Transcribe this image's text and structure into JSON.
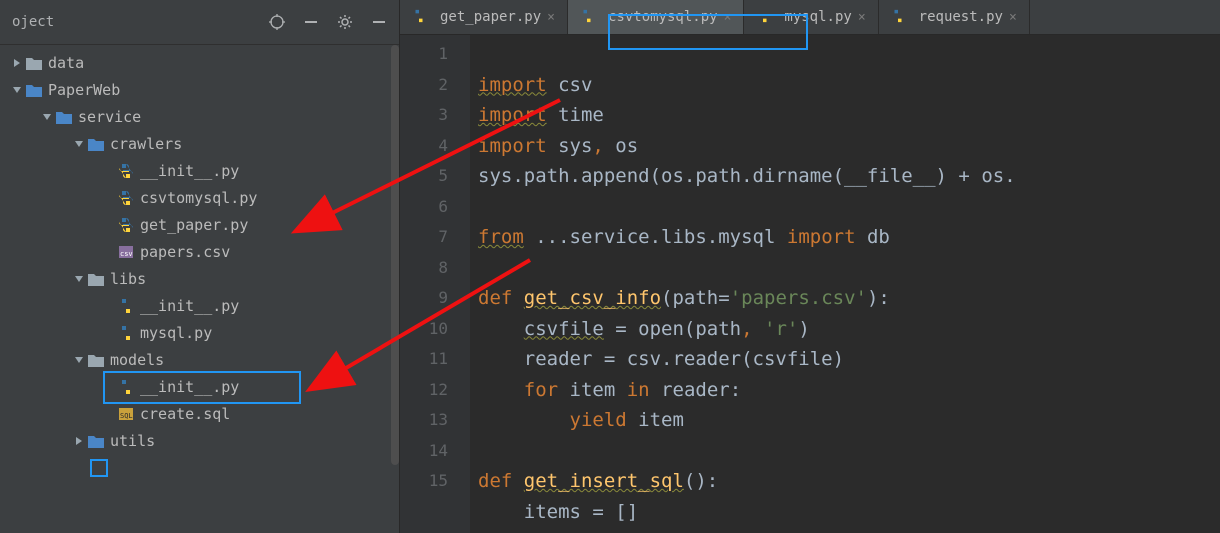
{
  "toolbar": {
    "title": "oject"
  },
  "tree": {
    "data": {
      "label": "data"
    },
    "paperweb": {
      "label": "PaperWeb"
    },
    "service": {
      "label": "service"
    },
    "crawlers": {
      "label": "crawlers"
    },
    "init1": {
      "label": "__init__.py"
    },
    "csvtomysql": {
      "label": "csvtomysql.py"
    },
    "getpaper": {
      "label": "get_paper.py"
    },
    "paperscsv": {
      "label": "papers.csv"
    },
    "libs": {
      "label": "libs"
    },
    "init2": {
      "label": "__init__.py"
    },
    "mysql": {
      "label": "mysql.py"
    },
    "models": {
      "label": "models"
    },
    "init3": {
      "label": "__init__.py"
    },
    "createsql": {
      "label": "create.sql"
    },
    "utils": {
      "label": "utils"
    }
  },
  "tabs": {
    "t0": {
      "label": "get_paper.py"
    },
    "t1": {
      "label": "csvtomysql.py"
    },
    "t2": {
      "label": "mysql.py"
    },
    "t3": {
      "label": "request.py"
    }
  },
  "lines": {
    "n1": "1",
    "n2": "2",
    "n3": "3",
    "n4": "4",
    "n5": "5",
    "n6": "6",
    "n7": "7",
    "n8": "8",
    "n9": "9",
    "n10": "10",
    "n11": "11",
    "n12": "12",
    "n13": "13",
    "n14": "14",
    "n15": "15"
  },
  "code": {
    "l1": {
      "kw": "import",
      "rest": " csv"
    },
    "l2": {
      "kw": "import",
      "rest": " time"
    },
    "l3": {
      "kw": "import",
      "rest": " sys",
      "comma": ", ",
      "rest2": "os"
    },
    "l4": {
      "text": "sys.path.append(os.path.dirname(__file__) + os."
    },
    "l5": {
      "text": ""
    },
    "l6": {
      "kw1": "from",
      "pkg": " ...service.libs.mysql ",
      "kw2": "import",
      "obj": " db"
    },
    "l7": {
      "text": ""
    },
    "l8": {
      "kw": "def ",
      "name": "get_csv_info",
      "open": "(path=",
      "str": "'papers.csv'",
      "close": "):"
    },
    "l9": {
      "indent": "    ",
      "var": "csvfile",
      "rest": " = open(path",
      "comma": ", ",
      "str": "'r'",
      "close": ")"
    },
    "l10": {
      "indent": "    ",
      "text": "reader = csv.reader(csvfile)"
    },
    "l11": {
      "indent": "    ",
      "kw1": "for ",
      "var": "item ",
      "kw2": "in ",
      "rest": "reader:"
    },
    "l12": {
      "indent": "        ",
      "kw": "yield ",
      "var": "item"
    },
    "l13": {
      "text": ""
    },
    "l14": {
      "kw": "def ",
      "name": "get_insert_sql",
      "rest": "():"
    },
    "l15": {
      "indent": "    ",
      "text": "items = []"
    }
  }
}
